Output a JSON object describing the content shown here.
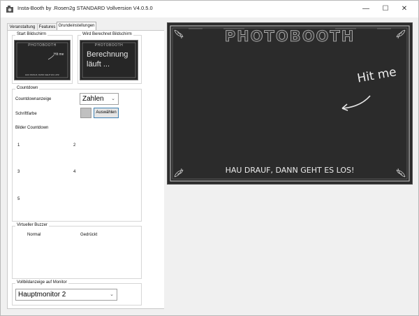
{
  "window": {
    "title": "Insta-Booth by .Rosen2g STANDARD Vollversion V4.0.5.0",
    "minimize_glyph": "—",
    "maximize_glyph": "☐",
    "close_glyph": "✕"
  },
  "tabs": [
    {
      "label": "Veranstaltung"
    },
    {
      "label": "Features"
    },
    {
      "label": "Grundeinstellungen"
    }
  ],
  "screens": {
    "start_title": "Start Bildschirm",
    "calc_title": "Wird Berechnet Bildschirm",
    "start_thumb_header": "PHOTOBOOTH",
    "start_thumb_hit": "Hit me",
    "start_thumb_footer": "HAU DRAUF, DANN GEHT ES LOS!",
    "calc_thumb_header": "PHOTOBOOTH",
    "calc_thumb_line1": "Berechnung",
    "calc_thumb_line2": "läuft ..."
  },
  "countdown": {
    "title": "Countdown",
    "display_label": "Countdownanzeige",
    "display_value": "Zahlen",
    "font_color_label": "Schriftfarbe",
    "select_button": "Auswählen",
    "images_label": "Bilder Countdown",
    "numbers": [
      "1",
      "2",
      "3",
      "4",
      "5"
    ]
  },
  "buzzer": {
    "title": "Virtueller Buzzer",
    "normal_label": "Normal",
    "pressed_label": "Gedrückt"
  },
  "monitor": {
    "title": "Vollbildanzeige auf Monitor",
    "value": "Hauptmonitor 2"
  },
  "preview": {
    "header": "PHOTOBOOTH",
    "hit_text": "Hit me",
    "footer": "HAU DRAUF, DANN GEHT ES LOS!"
  },
  "colors": {
    "chalkboard": "#2b2b2b",
    "chalk": "#e8e8e8",
    "accent_border": "#3c7fb1"
  }
}
